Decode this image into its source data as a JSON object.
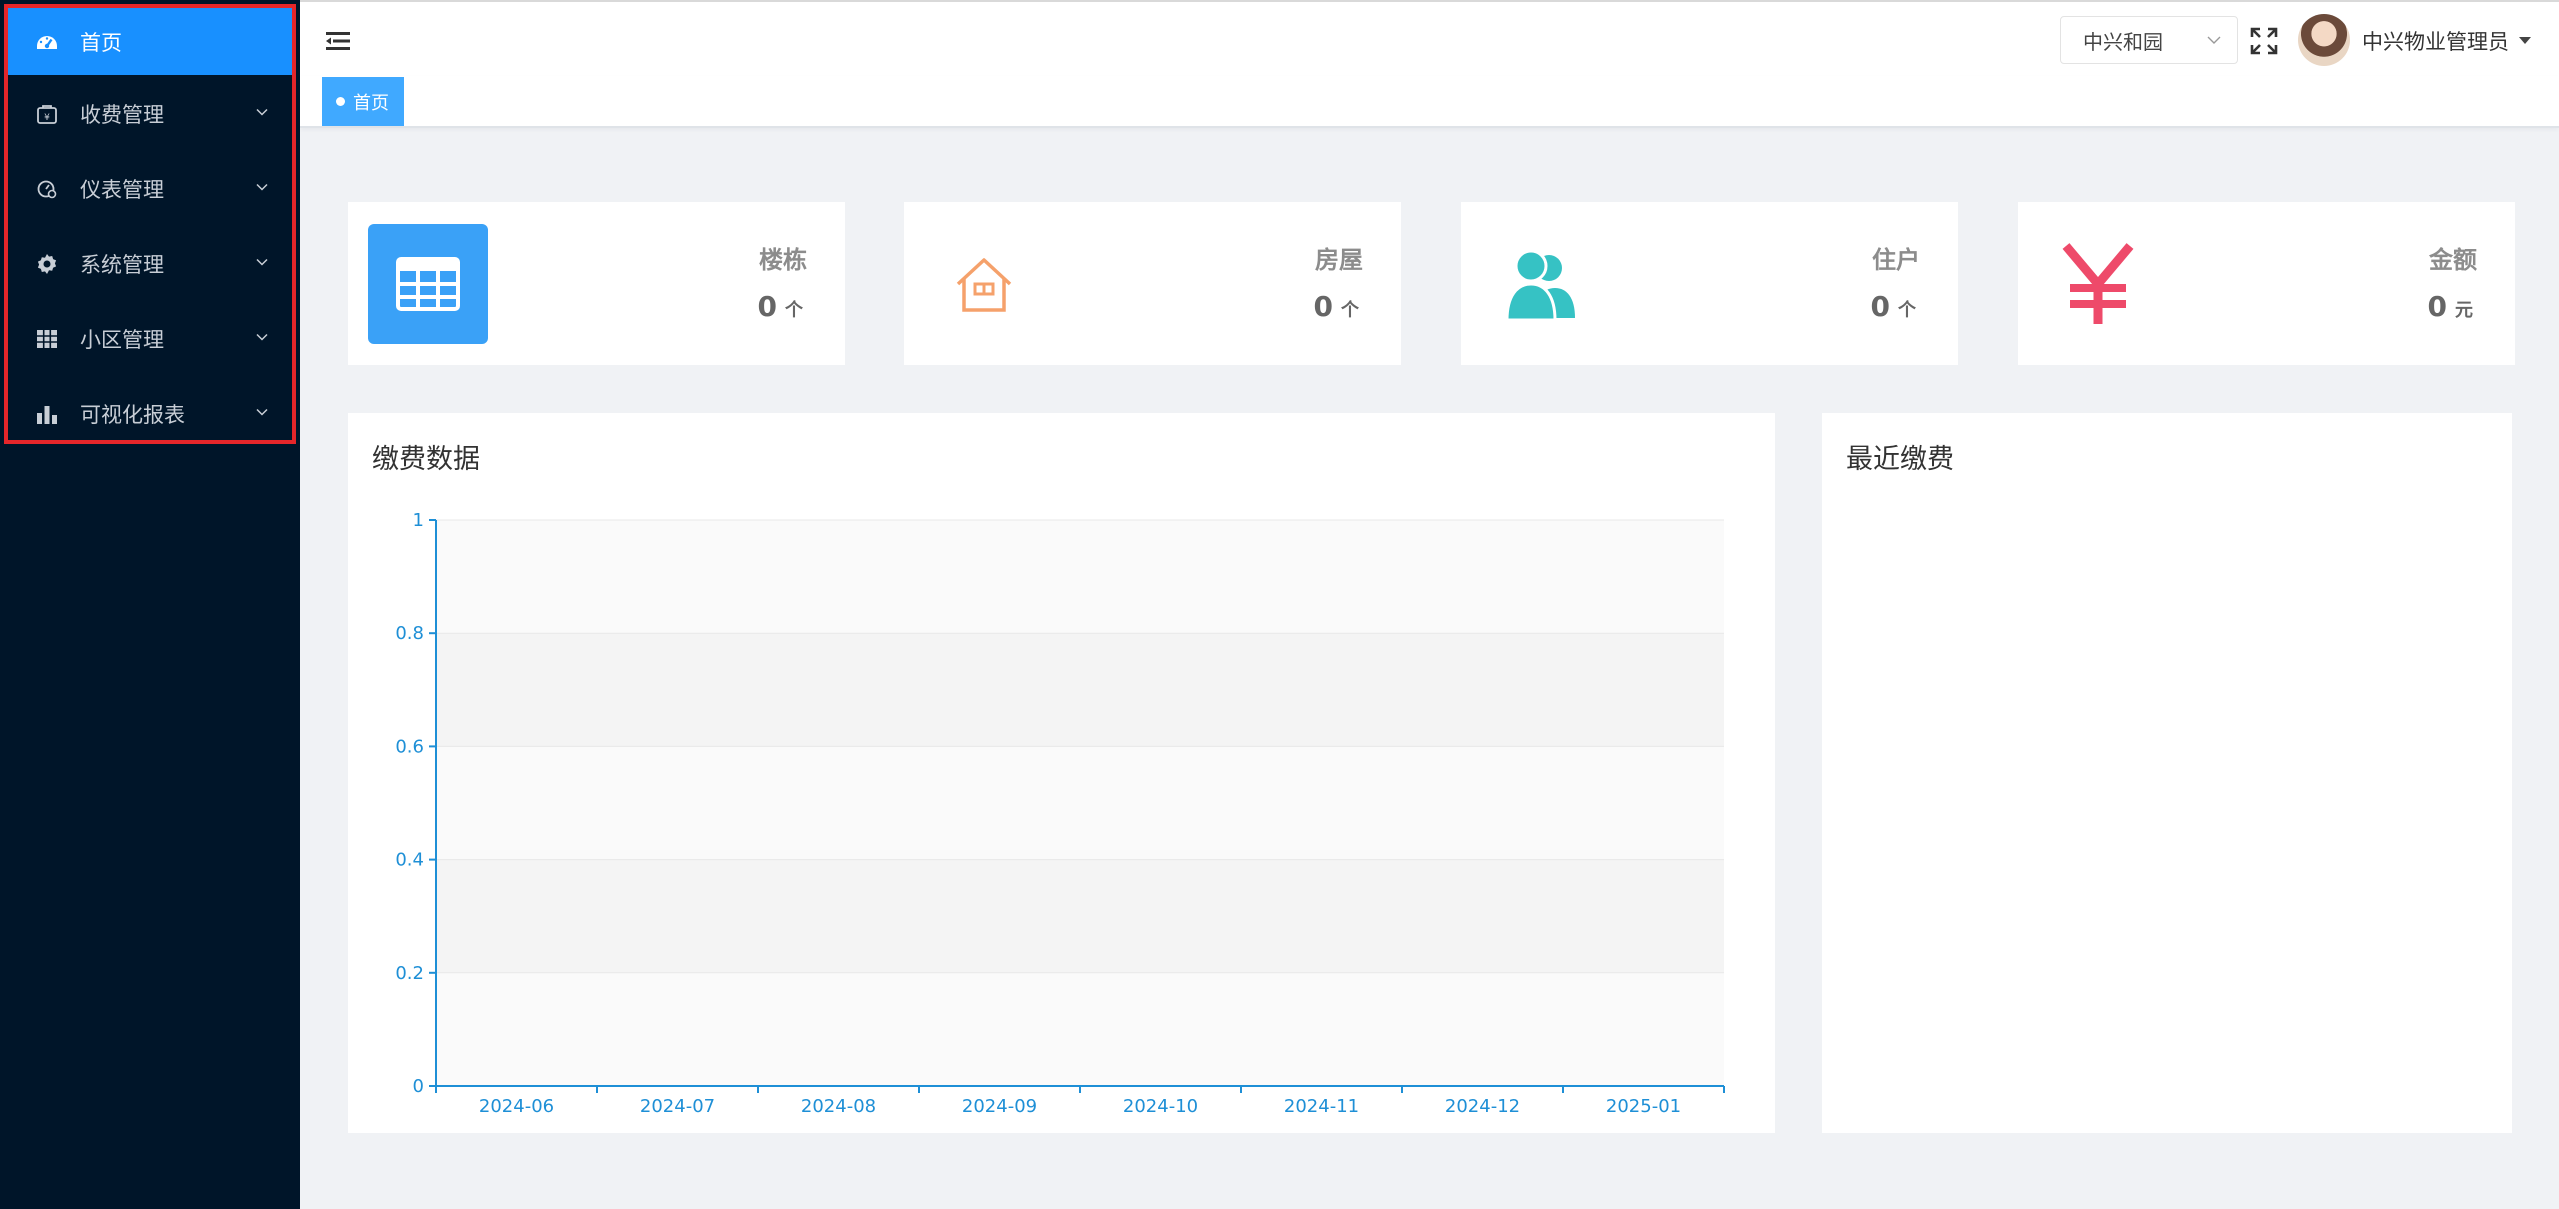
{
  "sidebar": {
    "items": [
      {
        "label": "首页",
        "icon": "dashboard-icon",
        "active": true
      },
      {
        "label": "收费管理",
        "icon": "payment-bag-icon"
      },
      {
        "label": "仪表管理",
        "icon": "meter-icon"
      },
      {
        "label": "系统管理",
        "icon": "gear-icon"
      },
      {
        "label": "小区管理",
        "icon": "grid-icon"
      },
      {
        "label": "可视化报表",
        "icon": "bar-chart-icon"
      }
    ]
  },
  "header": {
    "community_select": "中兴和园",
    "user_name": "中兴物业管理员"
  },
  "tabs": [
    {
      "label": "首页"
    }
  ],
  "stats": [
    {
      "label": "楼栋",
      "value": "0",
      "unit": "个",
      "icon": "table-icon",
      "color": "#3aa1f7"
    },
    {
      "label": "房屋",
      "value": "0",
      "unit": "个",
      "icon": "house-icon",
      "color": "#f5a16b"
    },
    {
      "label": "住户",
      "value": "0",
      "unit": "个",
      "icon": "users-icon",
      "color": "#36c2c4"
    },
    {
      "label": "金额",
      "value": "0",
      "unit": "元",
      "icon": "yen-icon",
      "color": "#ee4a6a"
    }
  ],
  "payment_panel": {
    "title": "缴费数据"
  },
  "recent_panel": {
    "title": "最近缴费"
  },
  "chart_data": {
    "type": "line",
    "categories": [
      "2024-06",
      "2024-07",
      "2024-08",
      "2024-09",
      "2024-10",
      "2024-11",
      "2024-12",
      "2025-01"
    ],
    "series": [],
    "yticks": [
      "0",
      "0.2",
      "0.4",
      "0.6",
      "0.8",
      "1"
    ],
    "ylim": [
      0,
      1
    ],
    "grid": true,
    "axis_color": "#1e8fd6"
  }
}
